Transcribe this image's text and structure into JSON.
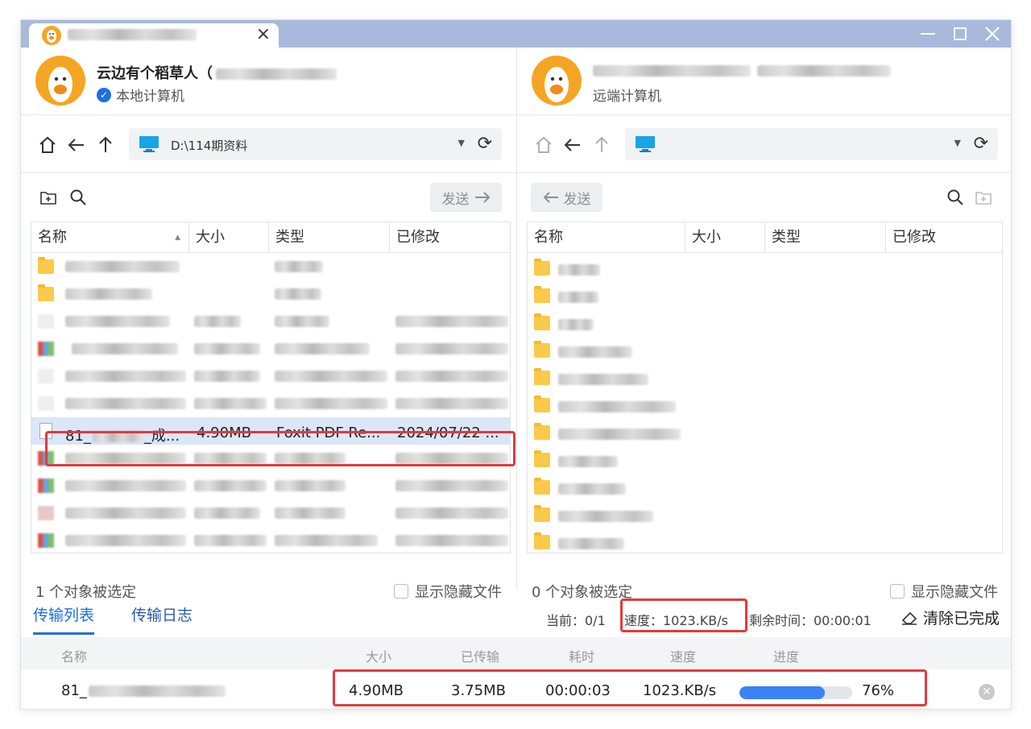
{
  "window": {
    "tab_title_blurred": true,
    "close_tab_glyph": "×",
    "controls": [
      "minimize",
      "maximize",
      "close"
    ]
  },
  "local": {
    "user_name": "云边有个稻草人（",
    "user_sub": "本地计算机",
    "path": "D:\\114期资料",
    "send_label": "发送",
    "columns": [
      "名称",
      "大小",
      "类型",
      "已修改"
    ],
    "selected_row": {
      "name": "81_",
      "name_suffix": "_成...",
      "size": "4.90MB",
      "type": "Foxit PDF Re...",
      "modified": "2024/07/22 ..."
    },
    "status": "1 个对象被选定",
    "show_hidden": "显示隐藏文件"
  },
  "remote": {
    "user_sub": "远端计算机",
    "path": "",
    "send_label": "发送",
    "columns": [
      "名称",
      "大小",
      "类型",
      "已修改"
    ],
    "status": "0 个对象被选定",
    "show_hidden": "显示隐藏文件"
  },
  "transfer": {
    "tabs": [
      "传输列表",
      "传输日志"
    ],
    "current": "当前：0/1",
    "speed": "速度：1023.KB/s",
    "remaining": "剩余时间：00:00:01",
    "clear_done": "清除已完成",
    "columns": [
      "名称",
      "大小",
      "已传输",
      "耗时",
      "速度",
      "进度"
    ],
    "row": {
      "name": "81_",
      "size": "4.90MB",
      "transferred": "3.75MB",
      "elapsed": "00:00:03",
      "speed": "1023.KB/s",
      "progress_label": "76%",
      "progress_value": 0.76
    }
  },
  "colors": {
    "accent": "#1d6fe0",
    "titlebar": "#a9b9dc",
    "highlight": "#e5393d",
    "progress": "#3b82f6",
    "folder": "#fcc94a"
  }
}
